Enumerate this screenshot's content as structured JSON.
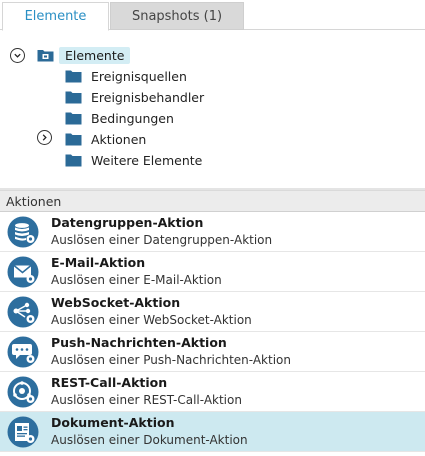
{
  "tabs": [
    {
      "label": "Elemente",
      "active": true
    },
    {
      "label": "Snapshots (1)",
      "active": false
    }
  ],
  "tree": {
    "root": {
      "label": "Elemente",
      "expanded": true,
      "icon": "elements-folder-icon"
    },
    "children": [
      {
        "label": "Ereignisquellen",
        "expandable": false
      },
      {
        "label": "Ereignisbehandler",
        "expandable": false
      },
      {
        "label": "Bedingungen",
        "expandable": false
      },
      {
        "label": "Aktionen",
        "expandable": true
      },
      {
        "label": "Weitere Elemente",
        "expandable": false
      }
    ]
  },
  "section": {
    "title": "Aktionen"
  },
  "actions": [
    {
      "title": "Datengruppen-Aktion",
      "description": "Auslösen einer Datengruppen-Aktion",
      "icon": "database-gear-icon",
      "selected": false
    },
    {
      "title": "E-Mail-Aktion",
      "description": "Auslösen einer E-Mail-Aktion",
      "icon": "email-gear-icon",
      "selected": false
    },
    {
      "title": "WebSocket-Aktion",
      "description": "Auslösen einer WebSocket-Aktion",
      "icon": "websocket-gear-icon",
      "selected": false
    },
    {
      "title": "Push-Nachrichten-Aktion",
      "description": "Auslösen einer Push-Nachrichten-Aktion",
      "icon": "chat-bubble-gear-icon",
      "selected": false
    },
    {
      "title": "REST-Call-Aktion",
      "description": "Auslösen einer REST-Call-Aktion",
      "icon": "rest-gear-icon",
      "selected": false
    },
    {
      "title": "Dokument-Aktion",
      "description": "Auslösen einer Dokument-Aktion",
      "icon": "document-gear-icon",
      "selected": true
    }
  ],
  "colors": {
    "accent": "#2a8fc4",
    "icon_blue": "#2d6e9e",
    "selection": "#cde9f0",
    "folder": "#2b6a97"
  }
}
